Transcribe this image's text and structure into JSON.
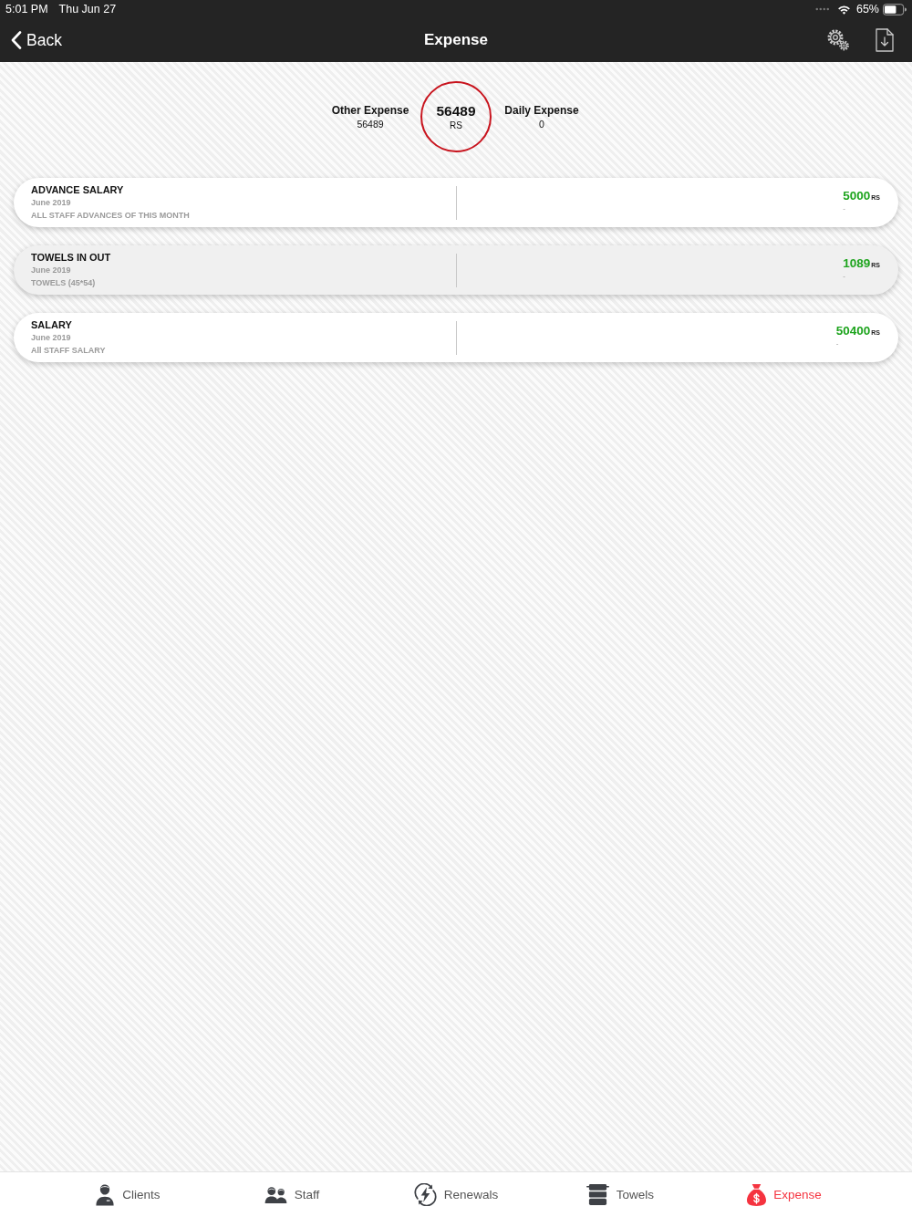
{
  "status_bar": {
    "time": "5:01 PM",
    "date": "Thu Jun 27",
    "battery": "65%"
  },
  "nav_bar": {
    "back": "Back",
    "title": "Expense"
  },
  "summary": {
    "other": {
      "label": "Other Expense",
      "value": "56489"
    },
    "total": {
      "value": "56489",
      "unit": "RS"
    },
    "daily": {
      "label": "Daily Expense",
      "value": "0"
    }
  },
  "expenses": [
    {
      "title": "ADVANCE SALARY",
      "date": "June 2019",
      "description": "ALL STAFF ADVANCES OF THIS MONTH",
      "amount": "5000",
      "unit": "RS",
      "note": "-",
      "selected": false
    },
    {
      "title": "TOWELS IN OUT",
      "date": "June 2019",
      "description": "TOWELS (45*54)",
      "amount": "1089",
      "unit": "RS",
      "note": "-",
      "selected": true
    },
    {
      "title": "SALARY",
      "date": "June 2019",
      "description": "All STAFF SALARY",
      "amount": "50400",
      "unit": "RS",
      "note": "-",
      "selected": false
    }
  ],
  "tab_bar": [
    {
      "kind": "clients",
      "label": "Clients",
      "selected": false
    },
    {
      "kind": "staff",
      "label": "Staff",
      "selected": false
    },
    {
      "kind": "renewals",
      "label": "Renewals",
      "selected": false
    },
    {
      "kind": "towels",
      "label": "Towels",
      "selected": false
    },
    {
      "kind": "expense",
      "label": "Expense",
      "selected": true
    }
  ]
}
